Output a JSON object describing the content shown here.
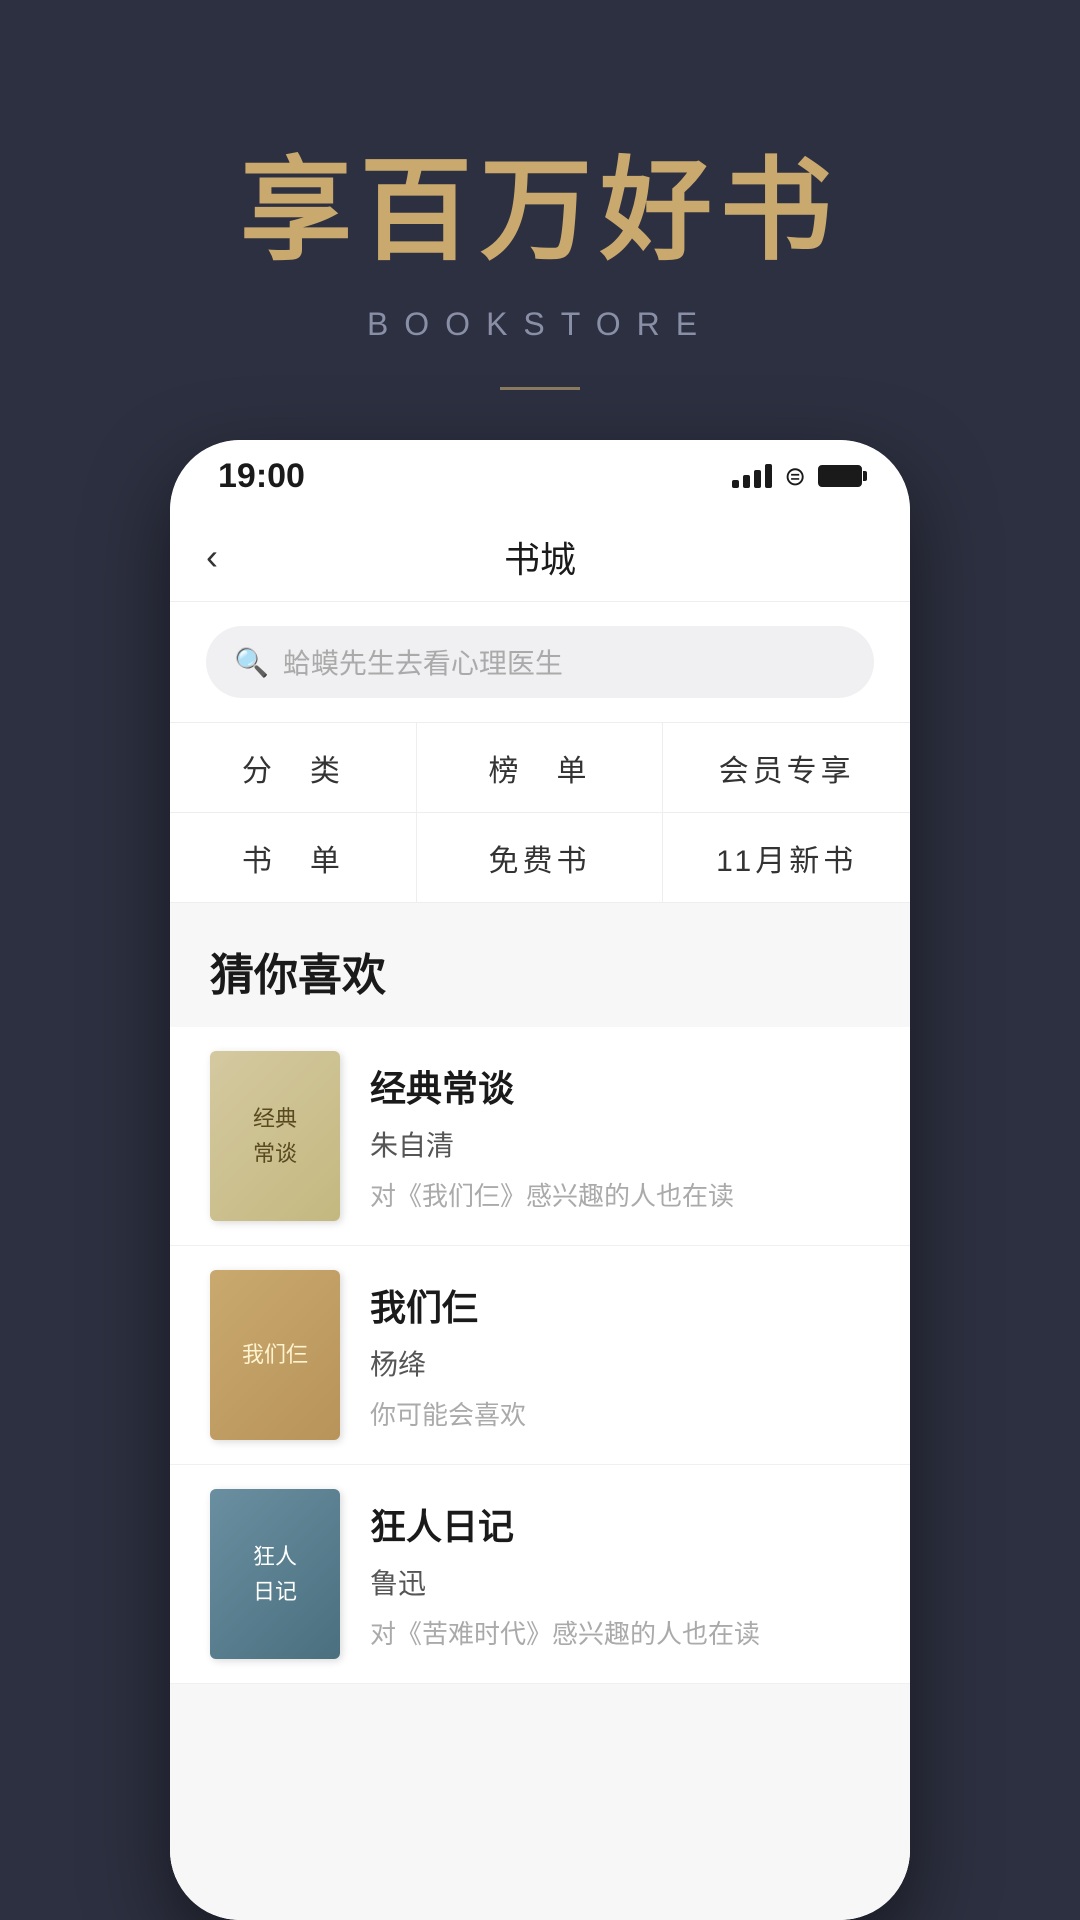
{
  "hero": {
    "title": "享百万好书",
    "subtitle": "BOOKSTORE",
    "divider": true
  },
  "statusBar": {
    "time": "19:00"
  },
  "nav": {
    "back_label": "‹",
    "title": "书城"
  },
  "search": {
    "placeholder": "蛤蟆先生去看心理医生"
  },
  "categories": [
    {
      "label": "分　类"
    },
    {
      "label": "榜　单"
    },
    {
      "label": "会员专享"
    },
    {
      "label": "书　单"
    },
    {
      "label": "免费书"
    },
    {
      "label": "11月新书"
    }
  ],
  "recommend": {
    "title": "猜你喜欢",
    "books": [
      {
        "name": "经典常谈",
        "author": "朱自清",
        "desc": "对《我们仨》感兴趣的人也在读",
        "cover_lines": [
          "经典",
          "常谈"
        ]
      },
      {
        "name": "我们仨",
        "author": "杨绛",
        "desc": "你可能会喜欢",
        "cover_lines": [
          "我们仨"
        ]
      },
      {
        "name": "狂人日记",
        "author": "鲁迅",
        "desc": "对《苦难时代》感兴趣的人也在读",
        "cover_lines": [
          "狂人",
          "日记"
        ]
      }
    ]
  }
}
